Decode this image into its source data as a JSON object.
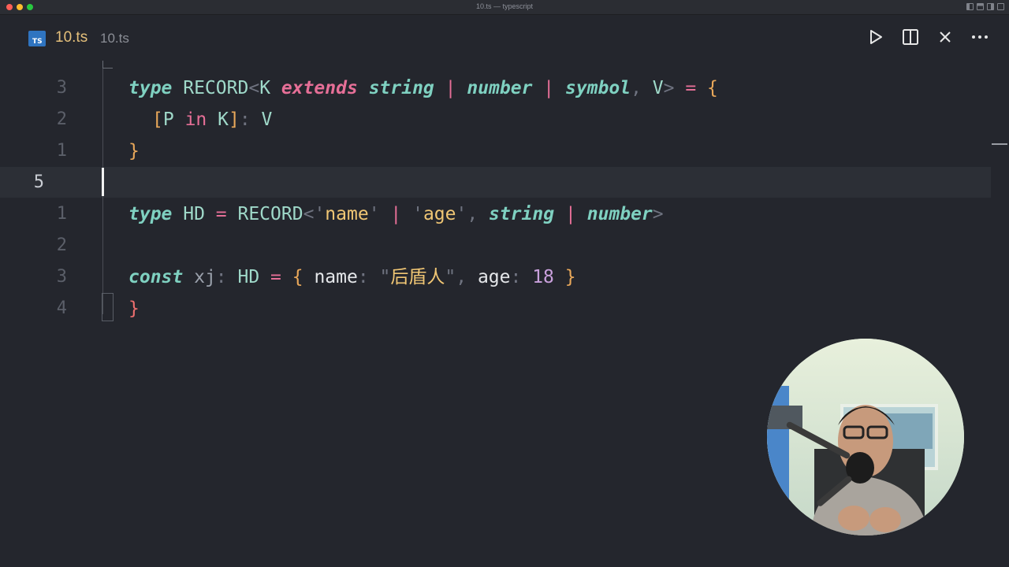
{
  "window": {
    "title": "10.ts — typescript"
  },
  "tab": {
    "icon_label": "TS",
    "name": "10.ts",
    "path": "10.ts"
  },
  "toolbar": {
    "icons": [
      "play-icon",
      "split-editor-icon",
      "close-icon",
      "more-icon"
    ]
  },
  "editor": {
    "lines": [
      {
        "number": "3",
        "tokens": [
          {
            "t": "type",
            "c": "kw"
          },
          {
            "t": " RECORD",
            "c": "ty"
          },
          {
            "t": "<",
            "c": "punct"
          },
          {
            "t": "K ",
            "c": "ty"
          },
          {
            "t": "extends",
            "c": "kw2"
          },
          {
            "t": " ",
            "c": ""
          },
          {
            "t": "string",
            "c": "kw"
          },
          {
            "t": " | ",
            "c": "pipe"
          },
          {
            "t": "number",
            "c": "kw"
          },
          {
            "t": " | ",
            "c": "pipe"
          },
          {
            "t": "symbol",
            "c": "kw"
          },
          {
            "t": ", ",
            "c": "punct"
          },
          {
            "t": "V",
            "c": "ty"
          },
          {
            "t": "> ",
            "c": "punct"
          },
          {
            "t": "= ",
            "c": "op"
          },
          {
            "t": "{",
            "c": "br"
          }
        ]
      },
      {
        "number": "2",
        "indent": true,
        "tokens": [
          {
            "t": "[",
            "c": "br"
          },
          {
            "t": "P ",
            "c": "ty"
          },
          {
            "t": "in",
            "c": "in-kw"
          },
          {
            "t": " K",
            "c": "ty"
          },
          {
            "t": "]",
            "c": "br"
          },
          {
            "t": ": ",
            "c": "punct"
          },
          {
            "t": "V",
            "c": "ty"
          }
        ]
      },
      {
        "number": "1",
        "tokens": [
          {
            "t": "}",
            "c": "br"
          }
        ]
      },
      {
        "number": "5",
        "active": true,
        "tokens": []
      },
      {
        "number": "1",
        "tokens": [
          {
            "t": "type",
            "c": "kw"
          },
          {
            "t": " HD ",
            "c": "ty"
          },
          {
            "t": "= ",
            "c": "op"
          },
          {
            "t": "RECORD",
            "c": "ty"
          },
          {
            "t": "<",
            "c": "punct"
          },
          {
            "t": "'",
            "c": "punct"
          },
          {
            "t": "name",
            "c": "str"
          },
          {
            "t": "' ",
            "c": "punct"
          },
          {
            "t": "| ",
            "c": "pipe"
          },
          {
            "t": "'",
            "c": "punct"
          },
          {
            "t": "age",
            "c": "str"
          },
          {
            "t": "', ",
            "c": "punct"
          },
          {
            "t": "string",
            "c": "kw"
          },
          {
            "t": " | ",
            "c": "pipe"
          },
          {
            "t": "number",
            "c": "kw"
          },
          {
            "t": ">",
            "c": "punct"
          }
        ]
      },
      {
        "number": "2",
        "tokens": []
      },
      {
        "number": "3",
        "tokens": [
          {
            "t": "const",
            "c": "kw"
          },
          {
            "t": " xj",
            "c": "var"
          },
          {
            "t": ": ",
            "c": "punct"
          },
          {
            "t": "HD ",
            "c": "ty"
          },
          {
            "t": "= ",
            "c": "op"
          },
          {
            "t": "{ ",
            "c": "br"
          },
          {
            "t": "name",
            "c": "prop"
          },
          {
            "t": ": ",
            "c": "punct"
          },
          {
            "t": "\"",
            "c": "punct"
          },
          {
            "t": "后盾人",
            "c": "str"
          },
          {
            "t": "\", ",
            "c": "punct"
          },
          {
            "t": "age",
            "c": "prop"
          },
          {
            "t": ": ",
            "c": "punct"
          },
          {
            "t": "18",
            "c": "num"
          },
          {
            "t": " }",
            "c": "br"
          }
        ]
      },
      {
        "number": "4",
        "tokens": [
          {
            "t": "}",
            "c": "hbr"
          }
        ]
      }
    ]
  },
  "colors": {
    "background": "#24262d",
    "accent": "#e5c07b",
    "keyword": "#7fd1c1",
    "operator": "#e66f97"
  }
}
